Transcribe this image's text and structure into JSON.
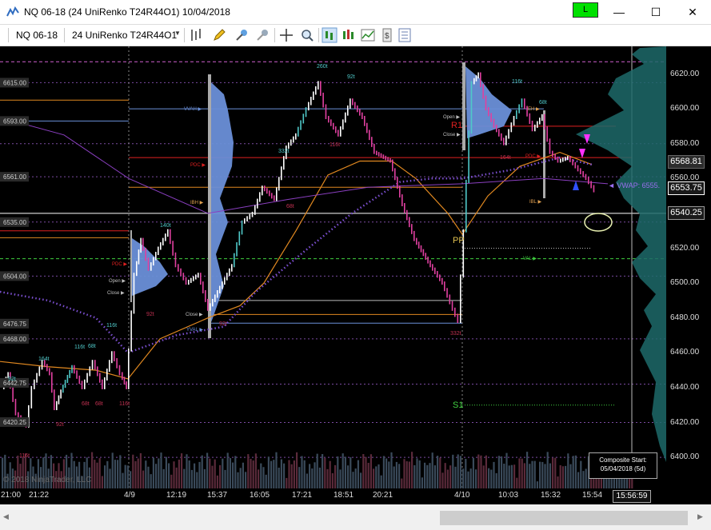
{
  "window": {
    "title": "NQ 06-18 (24 UniRenko T24R44O1)  10/04/2018",
    "connection_label": "L",
    "minimize": "—",
    "maximize": "☐",
    "close": "✕",
    "colors": {
      "connection": "#00e000"
    }
  },
  "toolbar": {
    "instrument": "NQ 06-18",
    "bar_type": "24 UniRenko T24R44O1",
    "icons": [
      "bar-style-icon",
      "pencil-drawing-icon",
      "pin-add-icon",
      "pin-remove-icon",
      "crosshair-icon",
      "zoom-icon",
      "chart-trader-icon",
      "strategies-icon",
      "indicators-icon",
      "templates-icon",
      "properties-icon"
    ]
  },
  "chart": {
    "watermark": "© 2018 NinjaTrader, LLC",
    "composite_box": {
      "line1": "Composite Start:",
      "line2": "05/04/2018 (5d)"
    },
    "pivot_labels": {
      "r1": "R1",
      "pp": "PP",
      "s1": "S1"
    },
    "vwap_label": "◄ VWAP: 6555.",
    "left_price_labels": [
      "6615.00",
      "6593.00",
      "6561.00",
      "6535.00",
      "6504.00",
      "6476.75",
      "6468.00",
      "6442.75",
      "6420.25"
    ],
    "profile_labels": {
      "vvah": "VVAH ▶",
      "pdc": "PDC ▶",
      "ibh": "IBH ▶",
      "open": "Open ▶",
      "close": "Close ▶",
      "yval": "YVAL ▶",
      "ibl": "IBL ▶",
      "eh": "EH ▶",
      "val": "VAL ▶"
    },
    "bar_tags": {
      "t260": "260t",
      "t92a": "92t",
      "t332": "332t",
      "t116a": "116t",
      "t68a": "68t",
      "t140": "140t",
      "t164": "164t",
      "t116b": "116t",
      "t68b": "68t",
      "t92b": "92t",
      "t116c": "116t",
      "t68c": "68t",
      "t68d": "68t",
      "t116d": "116t",
      "t92c": "92t",
      "t116e": "116t",
      "t332b": "332t",
      "t164b": "164t",
      "t92d": "92t",
      "t116f": "116t",
      "t68e": "68t",
      "t92e": "92t"
    },
    "colors": {
      "background": "#000000",
      "up_bar": "#ffffff",
      "up_bar_teal": "#4fc8c8",
      "down_bar": "#e040a0",
      "profile": "#6a8fd8",
      "vwap": "#7b4fd0",
      "ema": "#e08820",
      "pdc_line": "#e02020",
      "green_pivot": "#40d040",
      "last_price": "#ffffff"
    }
  },
  "price_axis": {
    "ticks": [
      "6620.00",
      "6600.00",
      "6580.00",
      "6560.00",
      "6540.00",
      "6520.00",
      "6500.00",
      "6480.00",
      "6460.00",
      "6440.00",
      "6420.00",
      "6400.00"
    ],
    "current_labels": {
      "high": "6568.81",
      "last": "6553.75",
      "low": "6540.25"
    }
  },
  "time_axis": {
    "labels": [
      "21:00",
      "21:22",
      "4/9",
      "12:19",
      "15:37",
      "16:05",
      "17:21",
      "18:51",
      "20:21",
      "4/10",
      "10:03",
      "15:32",
      "15:54"
    ],
    "current_time": "15:56:59"
  }
}
